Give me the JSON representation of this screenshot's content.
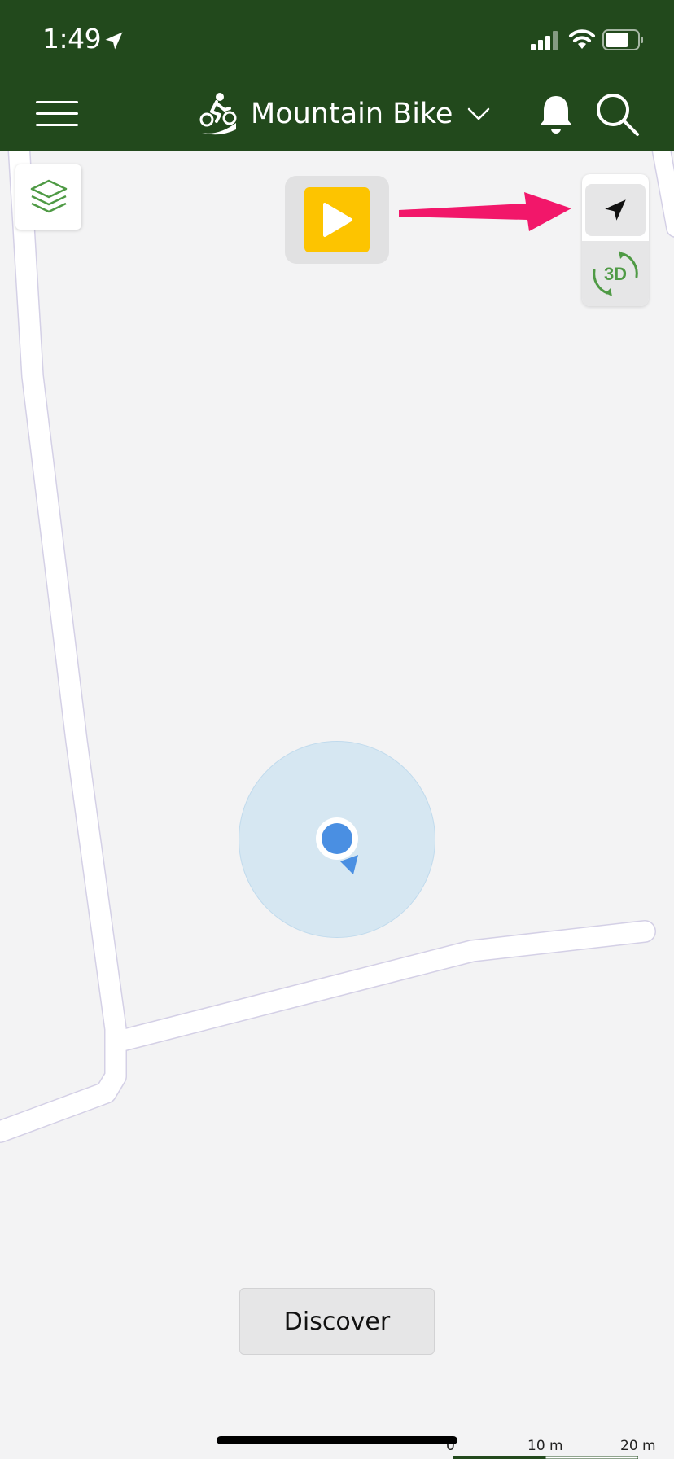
{
  "status_bar": {
    "time": "1:49",
    "location_icon": "location-arrow-icon",
    "signal_icon": "cellular-signal-icon",
    "wifi_icon": "wifi-icon",
    "battery_icon": "battery-icon"
  },
  "header": {
    "menu_icon": "hamburger-menu-icon",
    "activity_icon": "mountain-bike-icon",
    "activity_label": "Mountain Bike",
    "dropdown_icon": "chevron-down-icon",
    "notifications_icon": "bell-icon",
    "search_icon": "search-icon",
    "background_color": "#22491c"
  },
  "map": {
    "layers_icon": "layers-icon",
    "record_icon": "play-icon",
    "record_color": "#fdc400",
    "locate_icon": "navigation-arrow-icon",
    "view_3d_label": "3D",
    "view_3d_color": "#4f9a45",
    "annotation_arrow_color": "#f2176a",
    "user_marker_color": "#4a8fe2"
  },
  "discover_button": {
    "label": "Discover"
  },
  "scale": {
    "labels": [
      "0",
      "10 m",
      "20 m"
    ]
  }
}
